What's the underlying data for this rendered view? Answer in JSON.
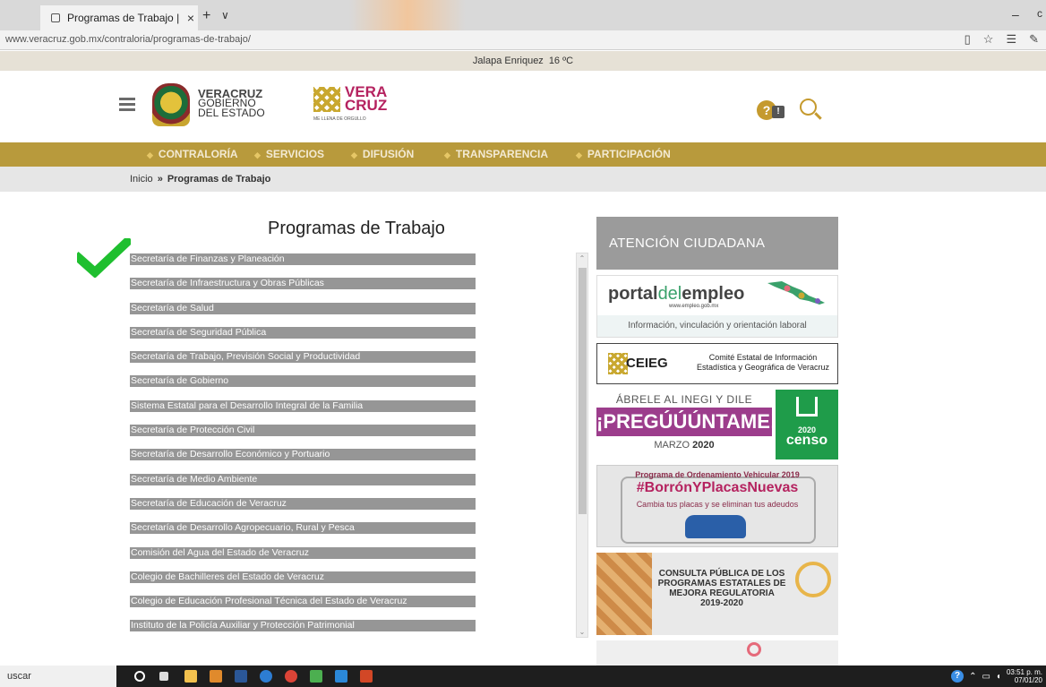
{
  "browser": {
    "tab_title": "Programas de Trabajo |",
    "tab_close": "×",
    "new_tab": "+",
    "tab_menu": "∨",
    "url": "www.veracruz.gob.mx/contraloria/programas-de-trabajo/",
    "minimize": "–",
    "extra": "c"
  },
  "weather": {
    "city": "Jalapa Enriquez",
    "temp": "16 ºC"
  },
  "header": {
    "gov_line1": "VERACRUZ",
    "gov_line2": "GOBIERNO",
    "gov_line3": "DEL ESTADO",
    "logo_word1": "VERA",
    "logo_word2": "CRUZ",
    "logo_tag": "ME LLENA DE ORGULLO",
    "help_mark": "?",
    "help_mark2": "!"
  },
  "nav": {
    "items": [
      "CONTRALORÍA",
      "SERVICIOS",
      "DIFUSIÓN",
      "TRANSPARENCIA",
      "PARTICIPACIÓN"
    ]
  },
  "breadcrumb": {
    "home": "Inicio",
    "separator": "»",
    "current": "Programas de Trabajo"
  },
  "main": {
    "title": "Programas de Trabajo",
    "items": [
      "Secretaría de Finanzas y Planeación",
      "Secretaría de Infraestructura y Obras Públicas",
      "Secretaría de Salud",
      "Secretaría de Seguridad Pública",
      "Secretaría de Trabajo, Previsión Social y Productividad",
      "Secretaría de Gobierno",
      "Sistema Estatal para el Desarrollo Integral de la Familia",
      "Secretaría de Protección Civil",
      "Secretaría de Desarrollo Económico y Portuario",
      "Secretaría de Medio Ambiente",
      "Secretaría de Educación de Veracruz",
      "Secretaría de Desarrollo Agropecuario, Rural y Pesca",
      "Comisión del Agua del Estado de Veracruz",
      "Colegio de Bachilleres del Estado de Veracruz",
      "Colegio de Educación Profesional Técnica del Estado de Veracruz",
      "Instituto de la Policía Auxiliar y Protección Patrimonial"
    ],
    "scroll_up": "⌃",
    "scroll_down": "⌄"
  },
  "sidebar": {
    "atencion": "ATENCIÓN CIUDADANA",
    "portal_logo_a": "portal",
    "portal_logo_b": "del",
    "portal_logo_c": "empleo",
    "portal_url": "www.empleo.gob.mx",
    "portal_foot": "Información, vinculación y orientación laboral",
    "ceieg_name": "CEIEG",
    "ceieg_line1": "Comité Estatal de Información",
    "ceieg_line2": "Estadística y Geográfica de Veracruz",
    "inegi_top": "ÁBRELE AL INEGI Y DILE",
    "inegi_mid": "¡PREGÚÚÚNTAME!",
    "inegi_bot_a": "MARZO",
    "inegi_bot_b": "2020",
    "censo_year": "2020",
    "censo_word": "censo",
    "placas_t1": "Programa de Ordenamiento Vehicular 2019",
    "placas_t2": "#BorrónYPlacasNuevas",
    "placas_t3": "Cambia tus placas y se eliminan tus adeudos",
    "consulta_l1": "CONSULTA PÚBLICA DE LOS",
    "consulta_l2": "PROGRAMAS ESTATALES DE",
    "consulta_l3": "MEJORA REGULATORIA",
    "consulta_l4": "2019-2020"
  },
  "taskbar": {
    "search": "uscar",
    "help": "?",
    "time": "03:51 p. m.",
    "date": "07/01/20"
  },
  "colors": {
    "nav_gold": "#b89a3c",
    "list_gray": "#969696",
    "check_green": "#1fbf2f",
    "inegi_purple": "#9c3d8c",
    "censo_green": "#1f9c4a"
  }
}
